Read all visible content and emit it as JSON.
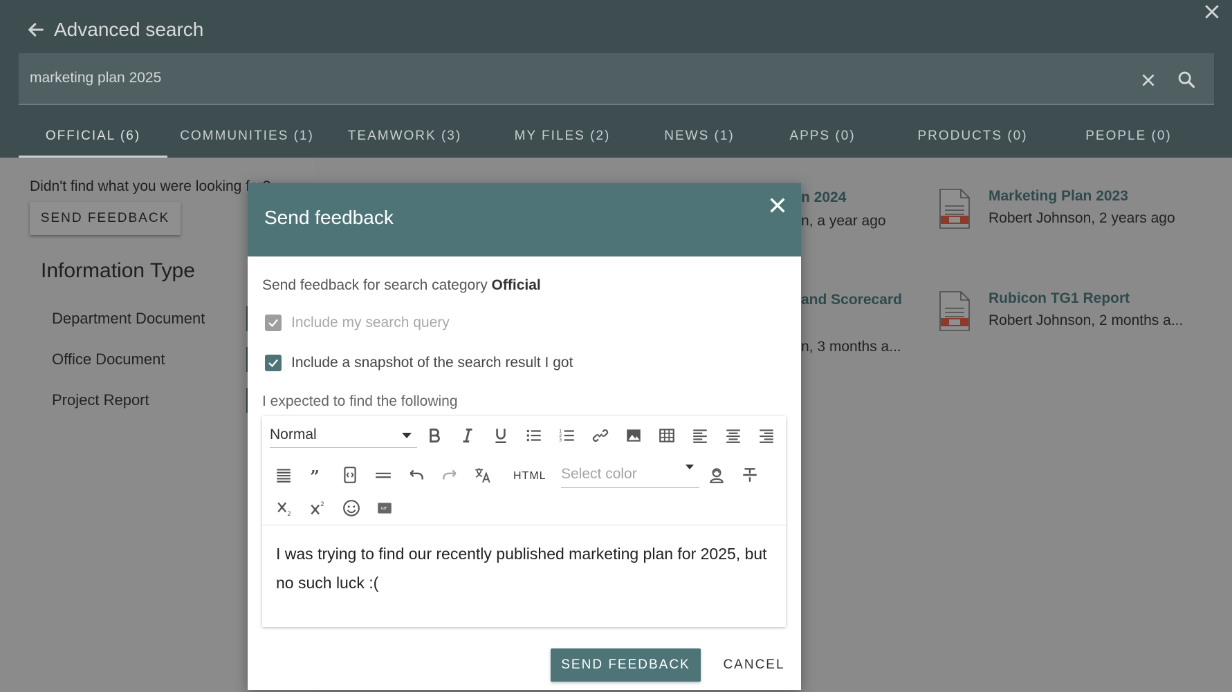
{
  "header": {
    "title": "Advanced search"
  },
  "search": {
    "query": "marketing plan 2025"
  },
  "tabs": [
    {
      "label": "OFFICIAL (6)",
      "active": true
    },
    {
      "label": "COMMUNITIES (1)",
      "active": false
    },
    {
      "label": "TEAMWORK (3)",
      "active": false
    },
    {
      "label": "MY FILES (2)",
      "active": false
    },
    {
      "label": "NEWS (1)",
      "active": false
    },
    {
      "label": "APPS (0)",
      "active": false
    },
    {
      "label": "PRODUCTS (0)",
      "active": false
    },
    {
      "label": "PEOPLE (0)",
      "active": false
    }
  ],
  "sidebar": {
    "didnt_find": "Didn't find what you were looking for?",
    "send_feedback_label": "SEND FEEDBACK",
    "info_title": "Information Type",
    "info_items": [
      "Department Document",
      "Office Document",
      "Project Report"
    ]
  },
  "results": {
    "peek_1_title": "n 2024",
    "peek_1_meta": "n, a year ago",
    "peek_2_title": "and Scorecard",
    "peek_2_meta": "n, 3 months a...",
    "items": [
      {
        "title": "Marketing Plan 2023",
        "meta": "Robert Johnson, 2 years ago"
      },
      {
        "title": "Rubicon TG1 Report",
        "meta": "Robert Johnson, 2 months a..."
      }
    ]
  },
  "modal": {
    "title": "Send feedback",
    "desc_prefix": "Send feedback for search category",
    "category": "Official",
    "include_query_label": "Include my search query",
    "include_snapshot_label": "Include a snapshot of the search result I got",
    "expect_label": "I expected to find the following",
    "format_value": "Normal",
    "html_label": "HTML",
    "color_placeholder": "Select color",
    "body_text": "I was trying to find our recently published marketing plan for 2025, but no such luck :(",
    "primary_label": "SEND FEEDBACK",
    "cancel_label": "CANCEL"
  },
  "colors": {
    "header_bg": "#3d4d50",
    "modal_accent": "#4e7478",
    "result_title": "#2f4a4d"
  },
  "icons": {
    "close": "close-icon",
    "back": "arrow-left-icon",
    "search": "search-icon",
    "document": "document-icon"
  }
}
